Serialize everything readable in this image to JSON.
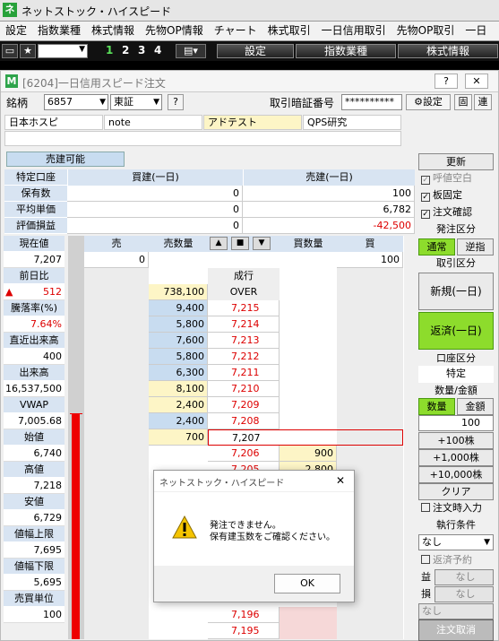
{
  "app": {
    "title": "ネットストック・ハイスピード"
  },
  "menu": [
    "設定",
    "指数業種",
    "株式情報",
    "先物OP情報",
    "チャート",
    "株式取引",
    "一日信用取引",
    "先物OP取引",
    "一日"
  ],
  "toolbar": {
    "nums": [
      "1",
      "2",
      "3",
      "4"
    ],
    "buttons": [
      "設定",
      "指数業種",
      "株式情報"
    ]
  },
  "window": {
    "title": "[6204]一日信用スピード注文",
    "help": "?",
    "close": "✕"
  },
  "order_bar": {
    "stock_label": "銘柄",
    "stock_code": "6857",
    "market": "東証",
    "q": "?",
    "pw_label": "取引暗証番号",
    "pw_value": "**********",
    "settings": "設定",
    "fixed": "固",
    "link": "連"
  },
  "news_tabs": [
    "日本ホスピ",
    "note",
    "アドテスト",
    "QPS研究"
  ],
  "position": {
    "sellable_label": "売建可能",
    "col_long": "買建(一日)",
    "col_short": "売建(一日)",
    "rows": [
      {
        "label": "特定口座",
        "long": "",
        "short": ""
      },
      {
        "label": "保有数",
        "long": "0",
        "short": "100"
      },
      {
        "label": "平均単価",
        "long": "0",
        "short": "6,782"
      },
      {
        "label": "評価損益",
        "long": "0",
        "short": "-42,500"
      }
    ]
  },
  "left_panel": [
    {
      "label": "現在値",
      "value": "7,207"
    },
    {
      "label": "前日比",
      "value": "512"
    },
    {
      "label": "騰落率(%)",
      "value": "7.64%"
    },
    {
      "label": "直近出来高",
      "value": "400"
    },
    {
      "label": "出来高",
      "value": "16,537,500"
    },
    {
      "label": "VWAP",
      "value": "7,005.68"
    },
    {
      "label": "始値",
      "value": "6,740"
    },
    {
      "label": "高値",
      "value": "7,218"
    },
    {
      "label": "安値",
      "value": "6,729"
    },
    {
      "label": "値幅上限",
      "value": "7,695"
    },
    {
      "label": "値幅下限",
      "value": "5,695"
    },
    {
      "label": "売買単位",
      "value": "100"
    }
  ],
  "board": {
    "headers": {
      "sell": "売",
      "sell_qty": "売数量",
      "buy_qty": "買数量",
      "buy": "買"
    },
    "sell_order": "0",
    "buy_order": "100",
    "market_label": "成行",
    "over": "OVER",
    "rows": [
      {
        "sell_qty": "738,100",
        "price": "OVER",
        "buy_qty": ""
      },
      {
        "sell_qty": "9,400",
        "price": "7,215",
        "buy_qty": ""
      },
      {
        "sell_qty": "5,800",
        "price": "7,214",
        "buy_qty": ""
      },
      {
        "sell_qty": "7,600",
        "price": "7,213",
        "buy_qty": ""
      },
      {
        "sell_qty": "5,800",
        "price": "7,212",
        "buy_qty": ""
      },
      {
        "sell_qty": "6,300",
        "price": "7,211",
        "buy_qty": ""
      },
      {
        "sell_qty": "8,100",
        "price": "7,210",
        "buy_qty": ""
      },
      {
        "sell_qty": "2,400",
        "price": "7,209",
        "buy_qty": ""
      },
      {
        "sell_qty": "2,400",
        "price": "7,208",
        "buy_qty": ""
      },
      {
        "sell_qty": "700",
        "price": "7,207",
        "buy_qty": ""
      },
      {
        "sell_qty": "",
        "price": "7,206",
        "buy_qty": "900"
      },
      {
        "sell_qty": "",
        "price": "7,205",
        "buy_qty": "2,800"
      }
    ],
    "bottom": [
      "7,196",
      "7,195"
    ]
  },
  "right_panel": {
    "update": "更新",
    "quote_blank": "呼値空白",
    "board_fixed": "板固定",
    "order_confirm": "注文確認",
    "order_type_label": "発注区分",
    "normal": "通常",
    "stop": "逆指",
    "trade_label": "取引区分",
    "new": "新規(一日)",
    "repay": "返済(一日)",
    "account_label": "口座区分",
    "account": "特定",
    "qty_label": "数量/金額",
    "qty": "数量",
    "amount": "金額",
    "qty_value": "100",
    "add100": "+100株",
    "add1000": "+1,000株",
    "add10000": "+10,000株",
    "clear": "クリア",
    "order_input": "注文時入力",
    "exec_label": "執行条件",
    "exec_value": "なし",
    "repay_reserve": "返済予約",
    "profit": "益",
    "loss": "損",
    "none": "なし",
    "cancel": "注文取消"
  },
  "dialog": {
    "title": "ネットストック・ハイスピード",
    "line1": "発注できません。",
    "line2": "保有建玉数をご確認ください。",
    "ok": "OK"
  }
}
